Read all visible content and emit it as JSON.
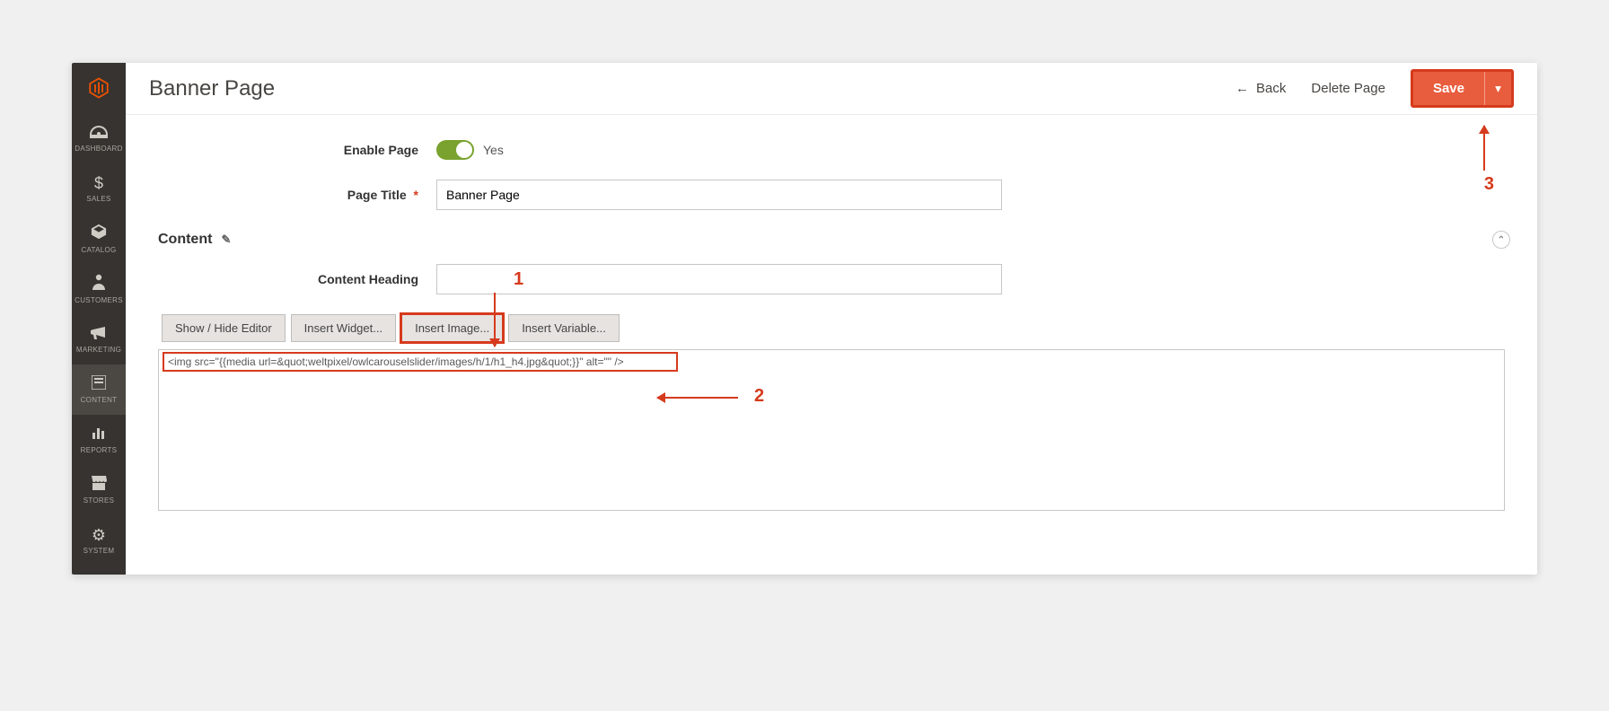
{
  "sidebar": {
    "items": [
      {
        "label": "DASHBOARD",
        "icon": "◉"
      },
      {
        "label": "SALES",
        "icon": "$"
      },
      {
        "label": "CATALOG",
        "icon": "❒"
      },
      {
        "label": "CUSTOMERS",
        "icon": "👤"
      },
      {
        "label": "MARKETING",
        "icon": "📣"
      },
      {
        "label": "CONTENT",
        "icon": "▦"
      },
      {
        "label": "REPORTS",
        "icon": "⫾"
      },
      {
        "label": "STORES",
        "icon": "🏬"
      },
      {
        "label": "SYSTEM",
        "icon": "⚙"
      }
    ]
  },
  "header": {
    "title": "Banner Page",
    "back": "Back",
    "delete": "Delete Page",
    "save": "Save"
  },
  "form": {
    "enable_label": "Enable Page",
    "enable_value": "Yes",
    "title_label": "Page Title",
    "title_value": "Banner Page",
    "content_section": "Content",
    "content_heading_label": "Content Heading",
    "content_heading_value": ""
  },
  "editor": {
    "buttons": {
      "toggle": "Show / Hide Editor",
      "widget": "Insert Widget...",
      "image": "Insert Image...",
      "variable": "Insert Variable..."
    },
    "code": "<img src=\"{{media url=&quot;weltpixel/owlcarouselslider/images/h/1/h1_h4.jpg&quot;}}\" alt=\"\" />"
  },
  "annotations": {
    "one": "1",
    "two": "2",
    "three": "3"
  },
  "colors": {
    "accent": "#e85d3d",
    "annotation": "#d63a1d",
    "toggle_on": "#79a22e",
    "sidebar": "#363330"
  }
}
